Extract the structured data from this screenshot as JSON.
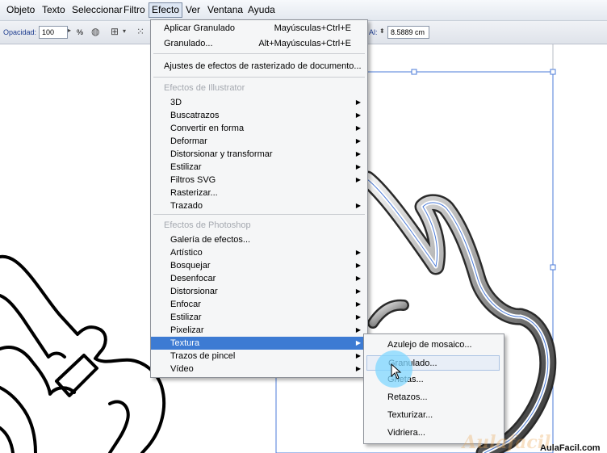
{
  "menubar": {
    "items": [
      "Objeto",
      "Texto",
      "Seleccionar",
      "Filtro",
      "Efecto",
      "Ver",
      "Ventana",
      "Ayuda"
    ]
  },
  "controlbar": {
    "opacity_label": "Opacidad:",
    "opacity_value": "100",
    "opacity_unit": "%",
    "height_label": "Al:",
    "height_value": "8.5889 cm"
  },
  "menu_efecto": {
    "apply_label": "Aplicar Granulado",
    "apply_shortcut": "Mayúsculas+Ctrl+E",
    "granulado_label": "Granulado...",
    "granulado_shortcut": "Alt+Mayúsculas+Ctrl+E",
    "raster_settings": "Ajustes de efectos de rasterizado de documento...",
    "illustrator_header": "Efectos de Illustrator",
    "illustrator_items": [
      "3D",
      "Buscatrazos",
      "Convertir en forma",
      "Deformar",
      "Distorsionar y transformar",
      "Estilizar",
      "Filtros SVG",
      "Rasterizar...",
      "Trazado"
    ],
    "photoshop_header": "Efectos de Photoshop",
    "photoshop_items": [
      "Galería de efectos...",
      "Artístico",
      "Bosquejar",
      "Desenfocar",
      "Distorsionar",
      "Enfocar",
      "Estilizar",
      "Pixelizar",
      "Textura",
      "Trazos de pincel",
      "Vídeo"
    ]
  },
  "submenu_textura": {
    "items": [
      "Azulejo de mosaico...",
      "Granulado...",
      "Grietas...",
      "Retazos...",
      "Texturizar...",
      "Vidriera..."
    ]
  },
  "watermark": {
    "ghost": "Aulafacil",
    "text": "AulaFacil.com"
  }
}
